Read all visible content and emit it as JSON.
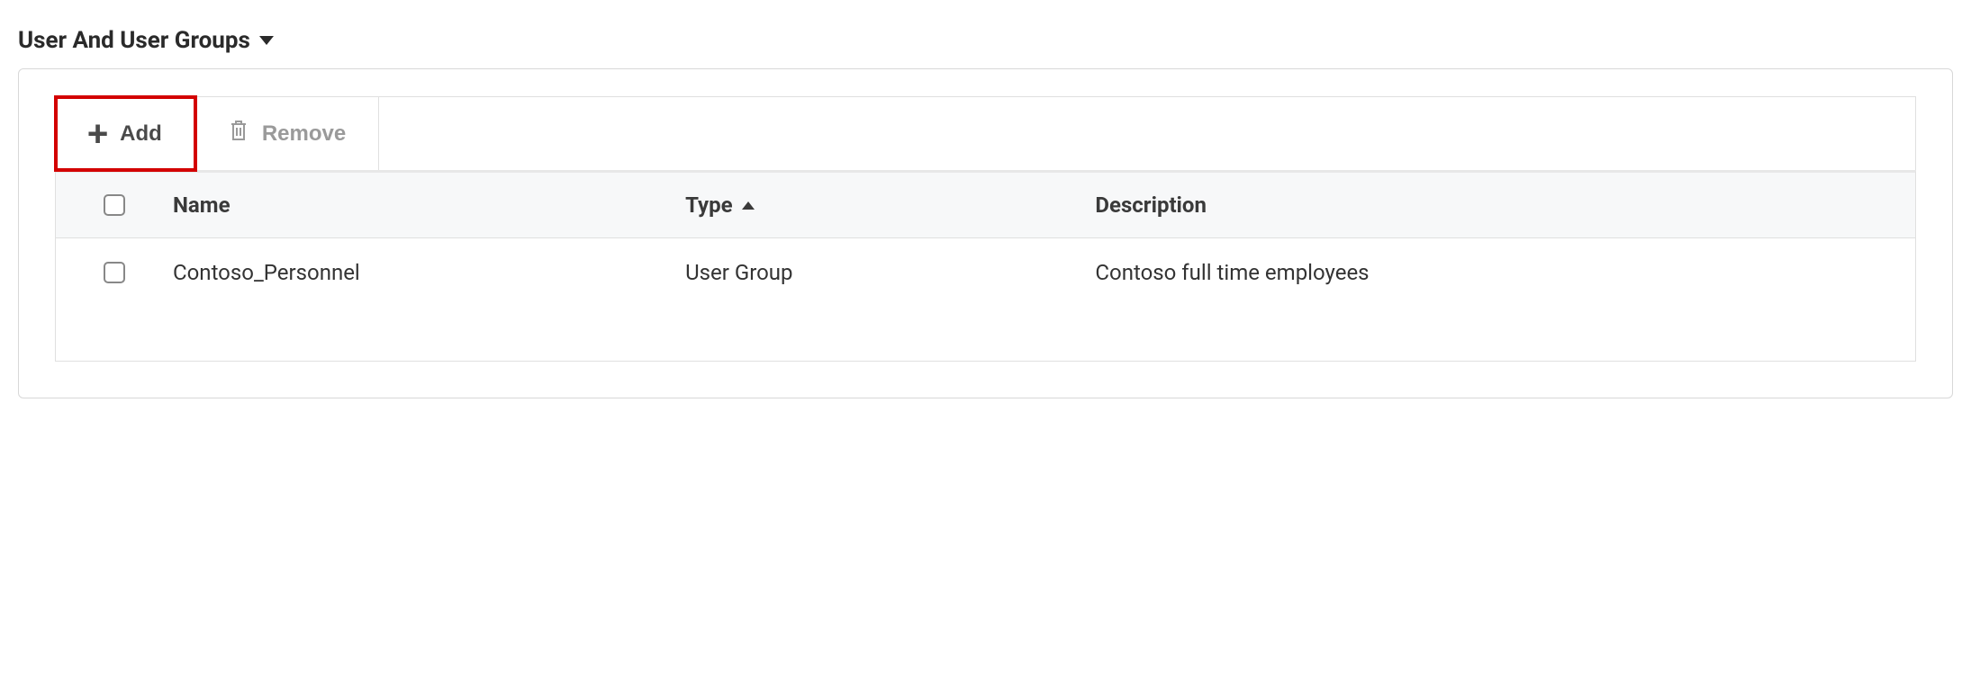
{
  "section": {
    "title": "User And User Groups"
  },
  "toolbar": {
    "add_label": "Add",
    "remove_label": "Remove"
  },
  "table": {
    "headers": {
      "name": "Name",
      "type": "Type",
      "description": "Description"
    },
    "rows": [
      {
        "name": "Contoso_Personnel",
        "type": "User Group",
        "description": "Contoso full time employees"
      }
    ]
  }
}
